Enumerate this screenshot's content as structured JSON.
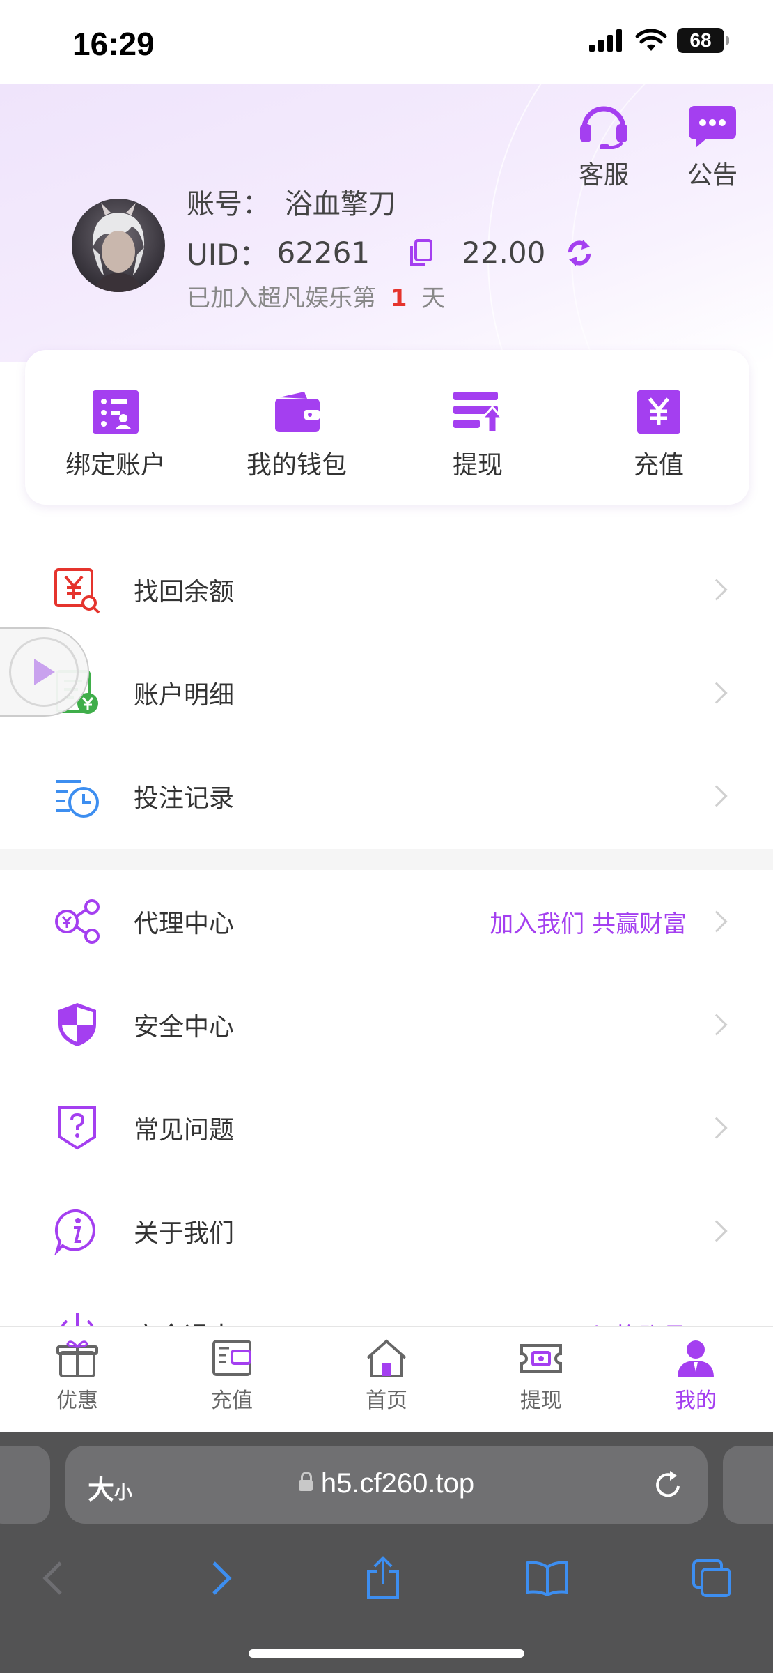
{
  "status_bar": {
    "time": "16:29",
    "battery": "68"
  },
  "header": {
    "service_label": "客服",
    "notice_label": "公告",
    "account_prefix": "账号：",
    "account_name": "浴血擎刀",
    "uid_prefix": "UID：",
    "uid": "62261",
    "balance": "22.00",
    "joined_prefix": "已加入超凡娱乐第",
    "joined_days": "1",
    "joined_suffix": "天"
  },
  "quick_actions": [
    {
      "label": "绑定账户",
      "icon": "bind-account-icon"
    },
    {
      "label": "我的钱包",
      "icon": "wallet-icon"
    },
    {
      "label": "提现",
      "icon": "withdraw-icon"
    },
    {
      "label": "充值",
      "icon": "recharge-icon"
    }
  ],
  "menu": {
    "recover_balance": "找回余额",
    "account_details": "账户明细",
    "bet_records": "投注记录",
    "agent_center": "代理中心",
    "agent_promo": "加入我们 共赢财富",
    "security_center": "安全中心",
    "faq": "常见问题",
    "about_us": "关于我们",
    "logout_partial": "安全退出",
    "switch_account_partial": "切换账号"
  },
  "tabbar": {
    "promo": "优惠",
    "recharge": "充值",
    "home": "首页",
    "withdraw": "提现",
    "mine": "我的"
  },
  "browser": {
    "text_size": "大",
    "text_size_small": "小",
    "url": "h5.cf260.top"
  },
  "colors": {
    "accent": "#a43ff0",
    "red": "#e5342d",
    "blue": "#3d8ef0",
    "green": "#3fae4a"
  }
}
